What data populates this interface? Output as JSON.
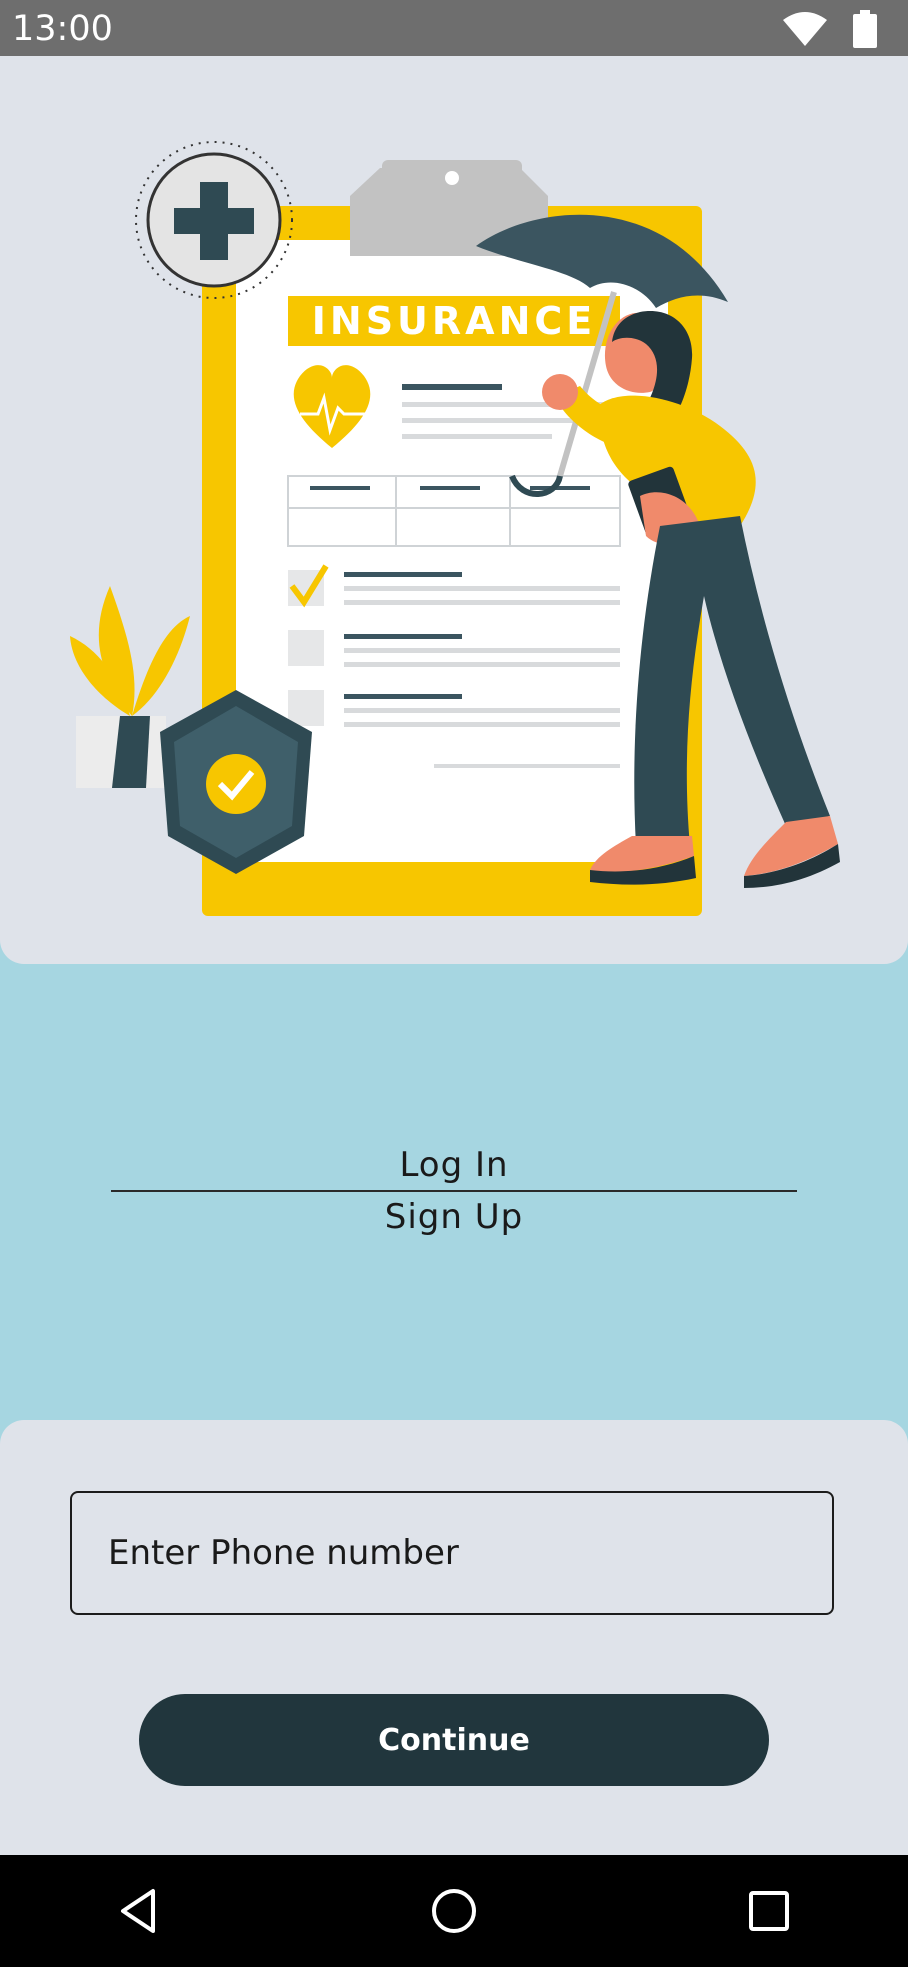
{
  "status_bar": {
    "time": "13:00",
    "icons": [
      "wifi-icon",
      "battery-icon"
    ]
  },
  "illustration": {
    "label": "INSURANCE"
  },
  "auth": {
    "login_label": "Log In",
    "signup_label": "Sign Up"
  },
  "form": {
    "phone_placeholder": "Enter Phone number",
    "continue_label": "Continue"
  },
  "nav_bar": {
    "icons": [
      "back-icon",
      "home-icon",
      "recents-icon"
    ]
  },
  "colors": {
    "background": "#a6d6e1",
    "card": "#dfe3ea",
    "button": "#21363d",
    "accent": "#f7c600",
    "dark_teal": "#2f4a53"
  }
}
